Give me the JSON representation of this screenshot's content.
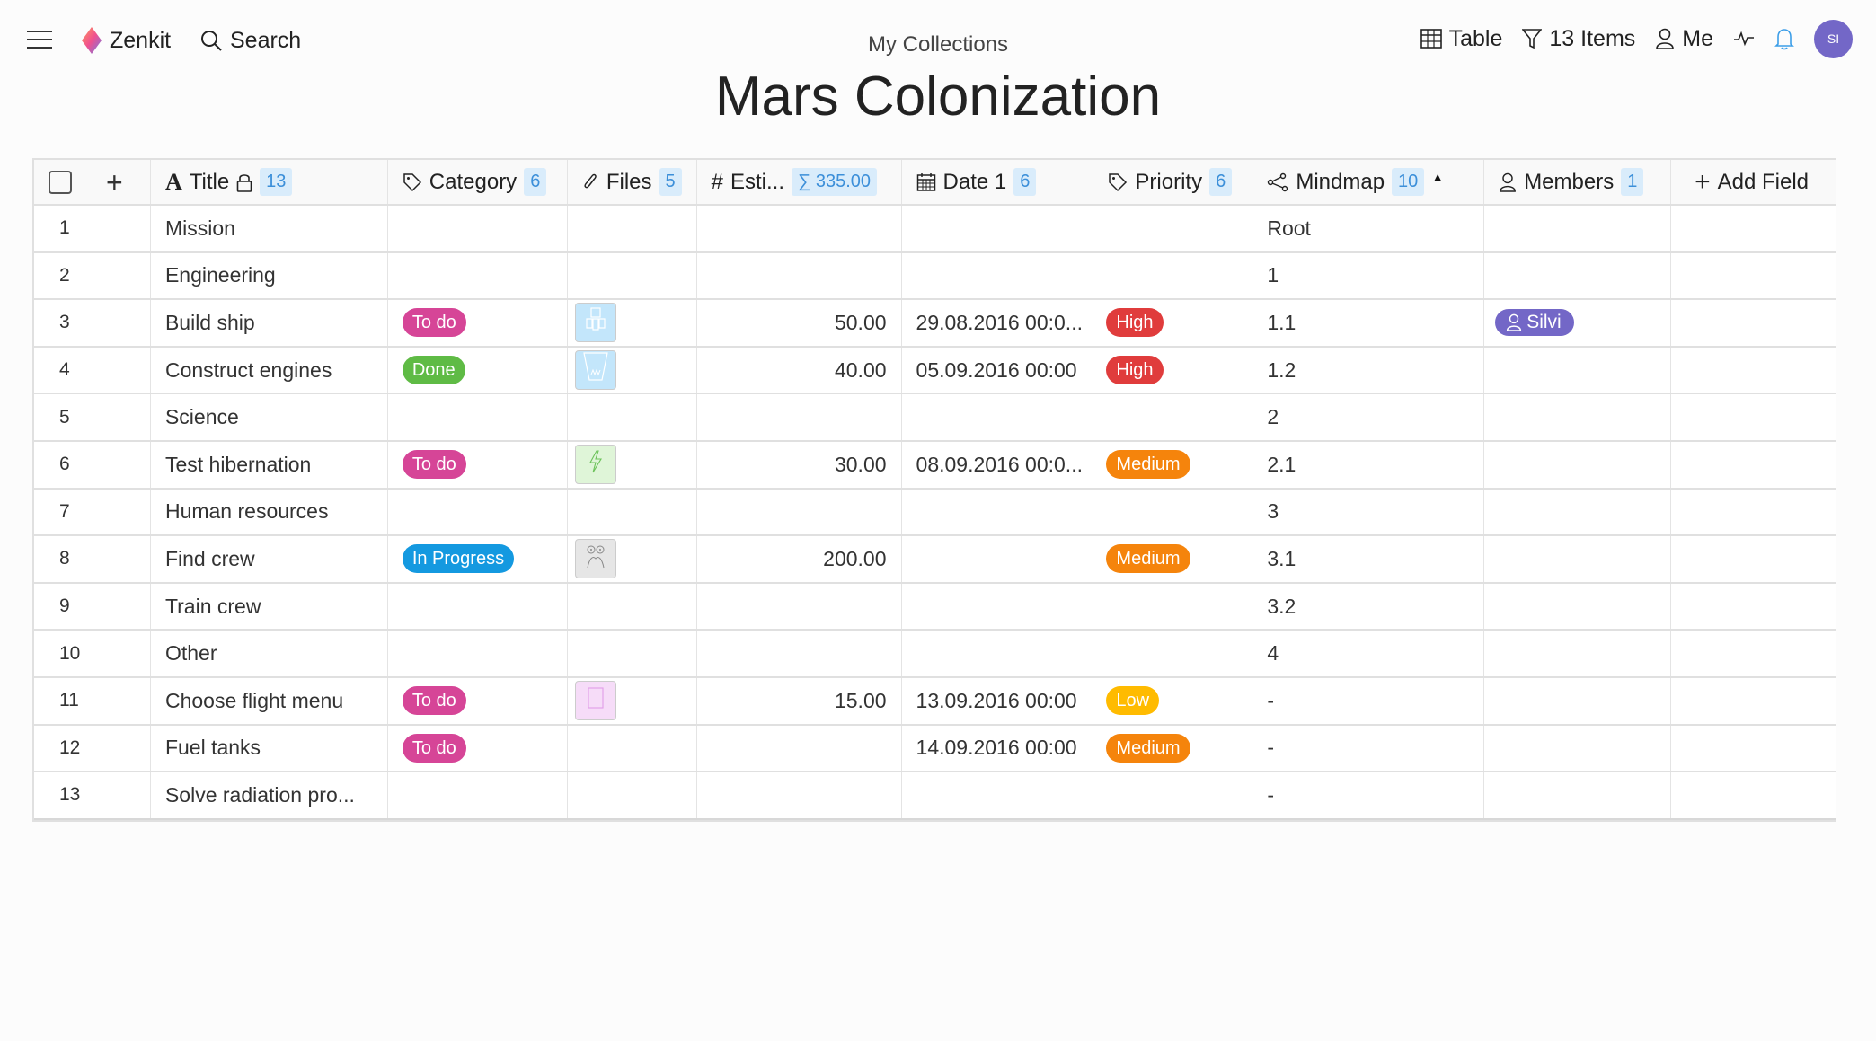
{
  "topbar": {
    "brand": "Zenkit",
    "search_label": "Search",
    "breadcrumb": "My Collections",
    "title": "Mars Colonization",
    "view_label": "Table",
    "filter_label": "13 Items",
    "me_label": "Me",
    "avatar_initials": "SI"
  },
  "colors": {
    "accent": "#3c8fd9",
    "avatar": "#7367c7",
    "todo": "#d64597",
    "done": "#5fbb45",
    "in_progress": "#1499e0",
    "high": "#e03c3c",
    "medium": "#f5840c",
    "low": "#ffbb00"
  },
  "table": {
    "headers": {
      "title": "Title",
      "title_count": "13",
      "category": "Category",
      "category_count": "6",
      "files": "Files",
      "files_count": "5",
      "estimate": "Esti...",
      "estimate_sum": "∑ 335.00",
      "date": "Date 1",
      "date_count": "6",
      "priority": "Priority",
      "priority_count": "6",
      "mindmap": "Mindmap",
      "mindmap_count": "10",
      "members": "Members",
      "members_count": "1",
      "add_field": "Add Field"
    },
    "rows": [
      {
        "n": "1",
        "title": "Mission",
        "category": "",
        "file": "",
        "estimate": "",
        "date": "",
        "priority": "",
        "mindmap": "Root",
        "member": ""
      },
      {
        "n": "2",
        "title": "Engineering",
        "category": "",
        "file": "",
        "estimate": "",
        "date": "",
        "priority": "",
        "mindmap": "1",
        "member": ""
      },
      {
        "n": "3",
        "title": "Build ship",
        "category": "To do",
        "file": "ship-thumbnail",
        "estimate": "50.00",
        "date": "29.08.2016 00:0...",
        "priority": "High",
        "mindmap": "1.1",
        "member": "Silvi"
      },
      {
        "n": "4",
        "title": "Construct engines",
        "category": "Done",
        "file": "engine-thumbnail",
        "estimate": "40.00",
        "date": "05.09.2016 00:00",
        "priority": "High",
        "mindmap": "1.2",
        "member": ""
      },
      {
        "n": "5",
        "title": "Science",
        "category": "",
        "file": "",
        "estimate": "",
        "date": "",
        "priority": "",
        "mindmap": "2",
        "member": ""
      },
      {
        "n": "6",
        "title": "Test hibernation",
        "category": "To do",
        "file": "lightning-thumbnail",
        "estimate": "30.00",
        "date": "08.09.2016 00:0...",
        "priority": "Medium",
        "mindmap": "2.1",
        "member": ""
      },
      {
        "n": "7",
        "title": "Human resources",
        "category": "",
        "file": "",
        "estimate": "",
        "date": "",
        "priority": "",
        "mindmap": "3",
        "member": ""
      },
      {
        "n": "8",
        "title": "Find crew",
        "category": "In Progress",
        "file": "alien-thumbnail",
        "estimate": "200.00",
        "date": "",
        "priority": "Medium",
        "mindmap": "3.1",
        "member": ""
      },
      {
        "n": "9",
        "title": "Train crew",
        "category": "",
        "file": "",
        "estimate": "",
        "date": "",
        "priority": "",
        "mindmap": "3.2",
        "member": ""
      },
      {
        "n": "10",
        "title": "Other",
        "category": "",
        "file": "",
        "estimate": "",
        "date": "",
        "priority": "",
        "mindmap": "4",
        "member": ""
      },
      {
        "n": "11",
        "title": "Choose flight menu",
        "category": "To do",
        "file": "menu-thumbnail",
        "estimate": "15.00",
        "date": "13.09.2016 00:00",
        "priority": "Low",
        "mindmap": "-",
        "member": ""
      },
      {
        "n": "12",
        "title": "Fuel tanks",
        "category": "To do",
        "file": "",
        "estimate": "",
        "date": "14.09.2016 00:00",
        "priority": "Medium",
        "mindmap": "-",
        "member": ""
      },
      {
        "n": "13",
        "title": "Solve radiation pro...",
        "category": "",
        "file": "",
        "estimate": "",
        "date": "",
        "priority": "",
        "mindmap": "-",
        "member": ""
      }
    ]
  }
}
